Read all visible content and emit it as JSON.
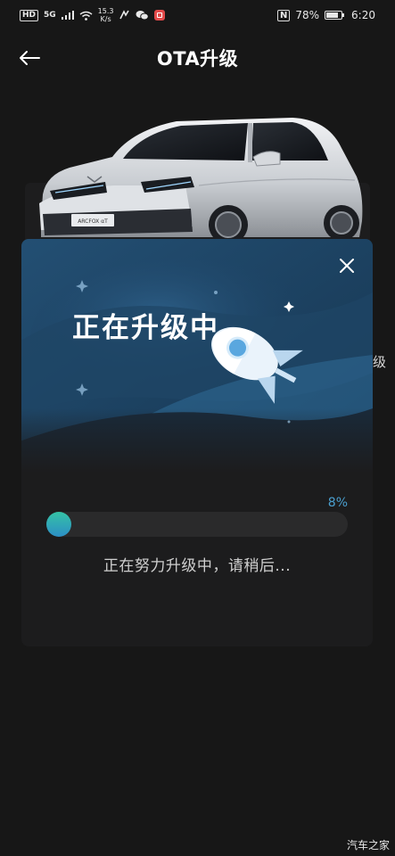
{
  "status_bar": {
    "hd": "HD",
    "network": "5G",
    "speed_value": "15.3",
    "speed_unit": "K/s",
    "nfc": "N",
    "battery_percent": "78%",
    "battery_level": 0.78,
    "time": "6:20"
  },
  "app_bar": {
    "title": "OTA升级"
  },
  "vehicle": {
    "plate_text": "ARCFOX αT"
  },
  "side_text": "级",
  "dialog": {
    "title": "正在升级中",
    "progress_percent_label": "8%",
    "progress_value": 0.08,
    "status_text": "正在努力升级中，请稍后..."
  },
  "watermark": "汽车之家",
  "colors": {
    "accent": "#4a9fcf",
    "progress_start": "#35c2a5",
    "progress_end": "#2c8fc6",
    "banner_dark": "#1a3d5c"
  },
  "icons": {
    "back": "arrow-left-icon",
    "close": "close-icon",
    "rocket": "rocket-icon"
  }
}
